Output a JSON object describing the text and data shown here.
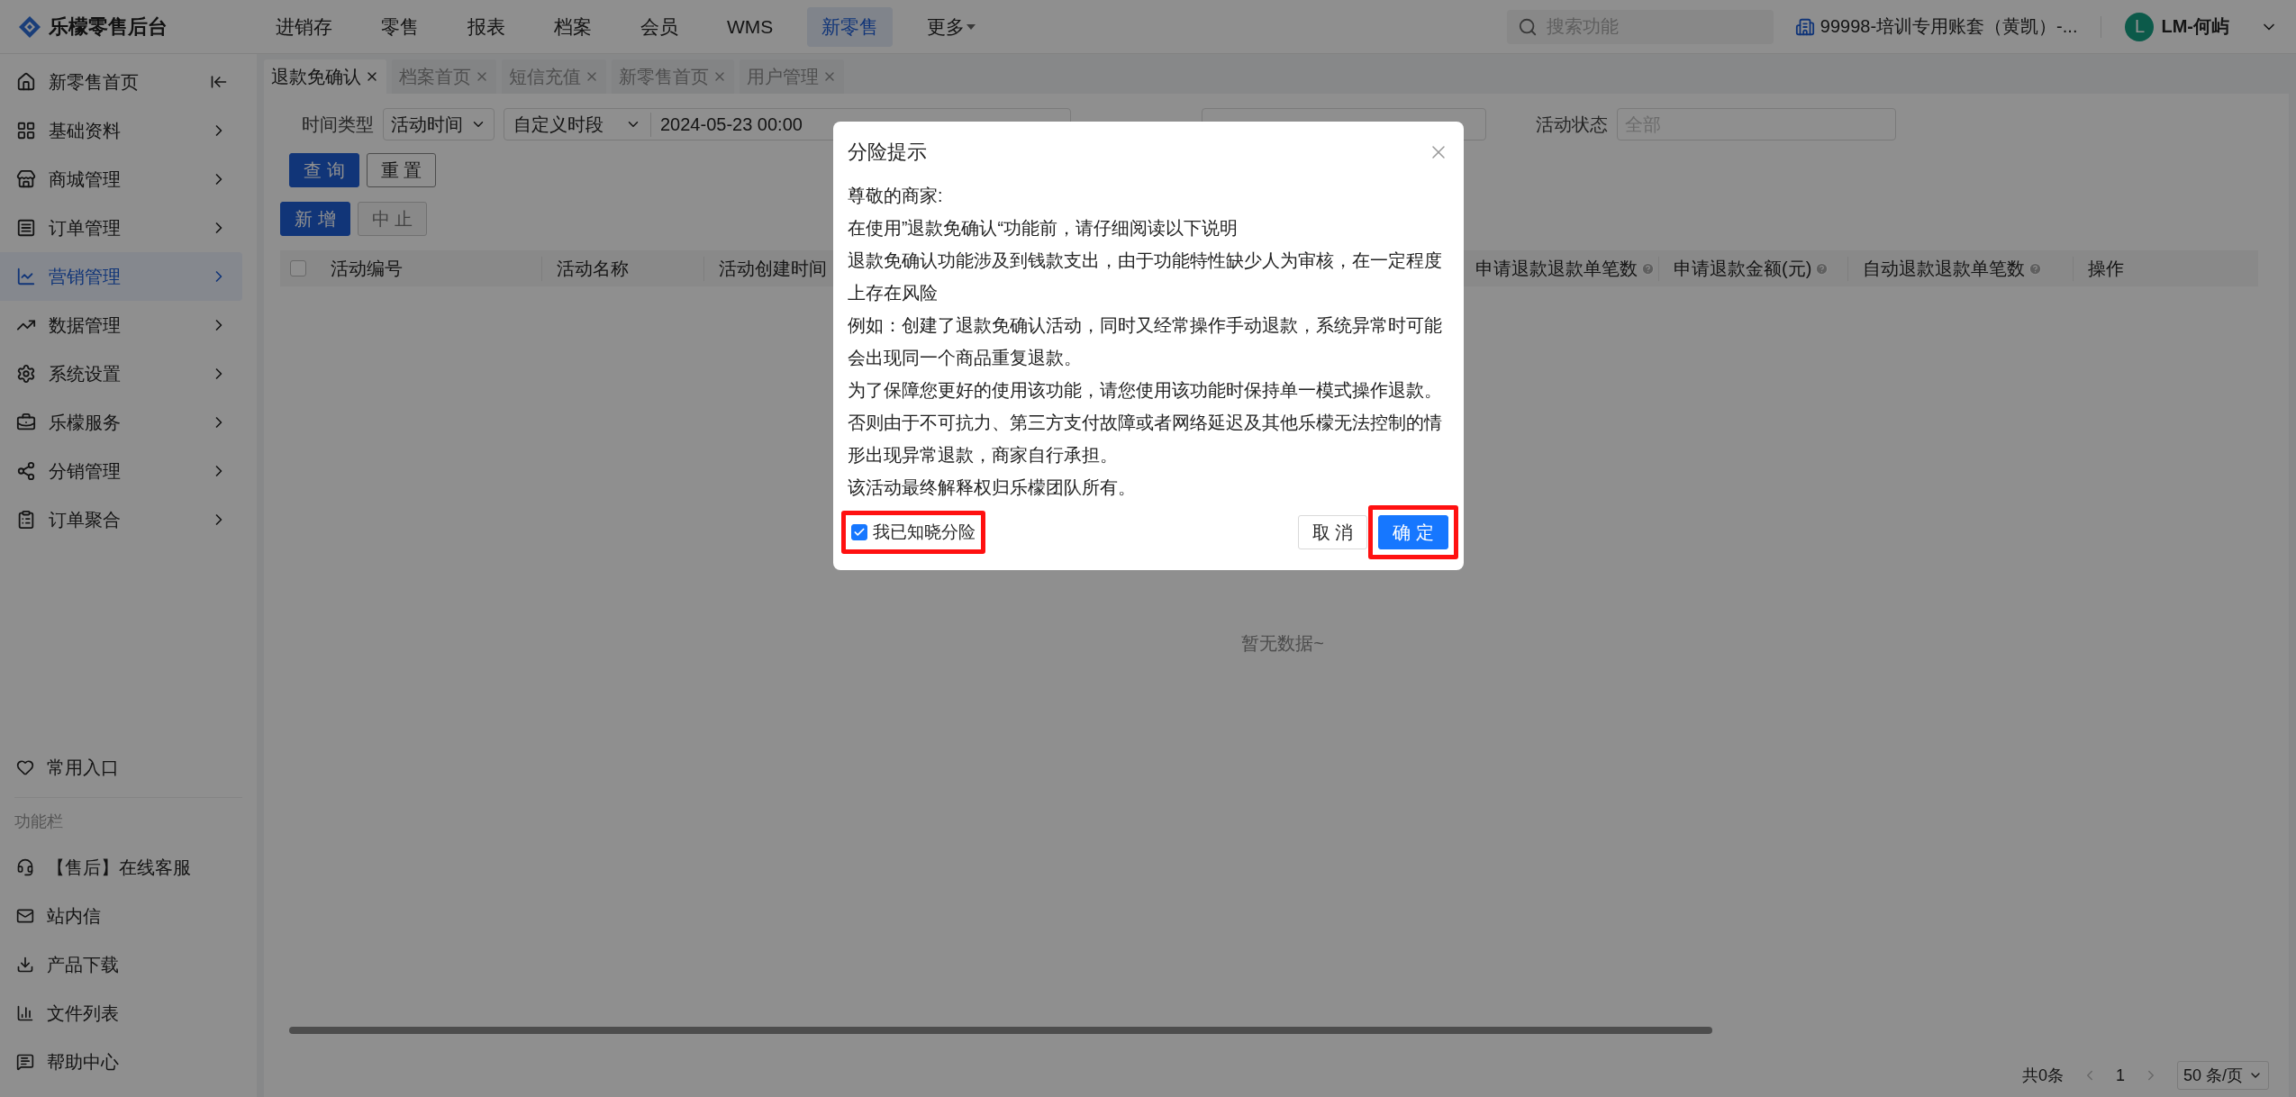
{
  "brand": {
    "name": "乐檬零售后台"
  },
  "top_nav": [
    {
      "label": "进销存",
      "selected": false,
      "kind": "link"
    },
    {
      "label": "零售",
      "selected": false,
      "kind": "link"
    },
    {
      "label": "报表",
      "selected": false,
      "kind": "link"
    },
    {
      "label": "档案",
      "selected": false,
      "kind": "link"
    },
    {
      "label": "会员",
      "selected": false,
      "kind": "link"
    },
    {
      "label": "WMS",
      "selected": false,
      "kind": "link"
    },
    {
      "label": "新零售",
      "selected": true,
      "kind": "link"
    },
    {
      "label": "更多",
      "selected": false,
      "kind": "dropdown"
    }
  ],
  "search": {
    "placeholder": "搜索功能"
  },
  "account": {
    "label": "99998-培训专用账套（黄凯）-..."
  },
  "user": {
    "initial": "L",
    "name": "LM-何屿"
  },
  "sidebar": {
    "items": [
      {
        "label": "新零售首页",
        "selected": false,
        "kind": "home"
      },
      {
        "label": "基础资料",
        "selected": false,
        "kind": "menu"
      },
      {
        "label": "商城管理",
        "selected": false,
        "kind": "menu"
      },
      {
        "label": "订单管理",
        "selected": false,
        "kind": "menu"
      },
      {
        "label": "营销管理",
        "selected": true,
        "kind": "menu"
      },
      {
        "label": "数据管理",
        "selected": false,
        "kind": "menu"
      },
      {
        "label": "系统设置",
        "selected": false,
        "kind": "menu"
      },
      {
        "label": "乐檬服务",
        "selected": false,
        "kind": "menu"
      },
      {
        "label": "分销管理",
        "selected": false,
        "kind": "menu"
      },
      {
        "label": "订单聚合",
        "selected": false,
        "kind": "menu"
      }
    ],
    "favorites": "常用入口",
    "section_title": "功能栏",
    "tools": [
      "【售后】在线客服",
      "站内信",
      "产品下载",
      "文件列表",
      "帮助中心"
    ]
  },
  "tabs": [
    {
      "label": "退款免确认",
      "selected": true
    },
    {
      "label": "档案首页",
      "selected": false
    },
    {
      "label": "短信充值",
      "selected": false
    },
    {
      "label": "新零售首页",
      "selected": false
    },
    {
      "label": "用户管理",
      "selected": false
    }
  ],
  "filters": {
    "time_type_label": "时间类型",
    "time_type": "活动时间",
    "range_type": "自定义时段",
    "start": "2024-05-23 00:00",
    "status_label": "活动状态",
    "status_placeholder": "全部"
  },
  "actions": [
    {
      "label": "查 询",
      "kind": "primary",
      "disabled": false
    },
    {
      "label": "重 置",
      "kind": "default",
      "disabled": false
    }
  ],
  "toolbar": [
    {
      "label": "新 增",
      "kind": "primary",
      "disabled": false
    },
    {
      "label": "中 止",
      "kind": "default",
      "disabled": true
    }
  ],
  "table": {
    "select_all": {
      "checked": false
    },
    "columns": [
      {
        "label": "活动编号",
        "help": false
      },
      {
        "label": "活动名称",
        "help": false
      },
      {
        "label": "活动创建时间",
        "help": false
      },
      {
        "label": "申请退款退款单笔数",
        "help": true
      },
      {
        "label": "申请退款金额(元)",
        "help": true
      },
      {
        "label": "自动退款退款单笔数",
        "help": true
      },
      {
        "label": "操作",
        "help": false
      }
    ],
    "empty": "暂无数据~"
  },
  "pagination": {
    "total": "共0条",
    "page": "1",
    "page_size": "50 条/页"
  },
  "modal": {
    "title": "分险提示",
    "paragraphs": [
      "尊敬的商家:",
      "在使用”退款免确认“功能前，请仔细阅读以下说明",
      "退款免确认功能涉及到钱款支出，由于功能特性缺少人为审核，在一定程度上存在风险",
      "例如：创建了退款免确认活动，同时又经常操作手动退款，系统异常时可能会出现同一个商品重复退款。",
      "为了保障您更好的使用该功能，请您使用该功能时保持单一模式操作退款。",
      "否则由于不可抗力、第三方支付故障或者网络延迟及其他乐檬无法控制的情形出现异常退款，商家自行承担。",
      "该活动最终解释权归乐檬团队所有。"
    ],
    "checkbox": {
      "label": "我已知晓分险",
      "checked": true,
      "highlighted": true
    },
    "cancel": {
      "label": "取 消",
      "highlighted": false
    },
    "ok": {
      "label": "确 定",
      "highlighted": true
    }
  }
}
